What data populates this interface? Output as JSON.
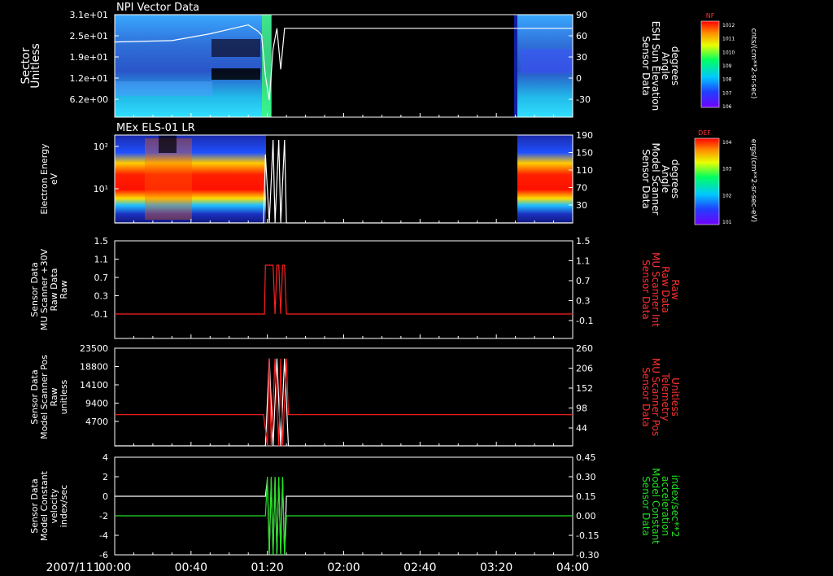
{
  "date_label": "2007/111",
  "time_ticks": [
    "00:00",
    "00:40",
    "01:20",
    "02:00",
    "02:40",
    "03:20",
    "04:00"
  ],
  "chart_data": [
    {
      "type": "heatmap",
      "title": "NPI Vector Data",
      "ylabel": [
        "Sector",
        "Unitless"
      ],
      "yticks": [
        "3.1e+01",
        "2.5e+01",
        "1.9e+01",
        "1.2e+01",
        "6.2e+00"
      ],
      "y2label": [
        "Sensor Data",
        "ESH Sun Elevation",
        "Angle",
        "degrees"
      ],
      "y2ticks": [
        "90",
        "60",
        "30",
        "0",
        "-30"
      ],
      "y2lim": [
        -60,
        90
      ],
      "colorbar": {
        "label": "NF",
        "unit": "cnts/(cm**2-sr-sec)",
        "ticks": [
          "10^12",
          "10^11",
          "10^10",
          "10^9",
          "10^8",
          "10^7",
          "10^6"
        ]
      },
      "series": [
        {
          "time_min": [
            0,
            30,
            50,
            70,
            75,
            77,
            79,
            81,
            83,
            85,
            87,
            89,
            240
          ],
          "values": [
            50,
            52,
            62,
            75,
            66,
            60,
            0,
            -35,
            40,
            70,
            10,
            70,
            70
          ]
        }
      ]
    },
    {
      "type": "heatmap",
      "title": "MEx ELS-01 LR",
      "ylabel": [
        "Electron Energy",
        "eV"
      ],
      "yticks": [
        "10^2",
        "10^1"
      ],
      "y2label": [
        "Sensor Data",
        "Model Scanner",
        "Angle",
        "degrees"
      ],
      "y2ticks": [
        "190",
        "150",
        "110",
        "70",
        "30"
      ],
      "y2lim": [
        10,
        190
      ],
      "colorbar": {
        "label": "DEF",
        "unit": "ergs/(cm**2-sr-sec-eV)",
        "ticks": [
          "10^4",
          "10^3",
          "10^2",
          "10^1"
        ]
      },
      "series": [
        {
          "time_min": [
            0,
            78,
            79,
            81,
            83,
            84,
            86,
            87,
            89,
            90,
            240
          ],
          "values": [
            10,
            10,
            150,
            10,
            180,
            10,
            180,
            10,
            180,
            10,
            10
          ]
        }
      ]
    },
    {
      "type": "line",
      "ylabel": [
        "Sensor Data",
        "MU Scanner +30V",
        "Raw Data",
        "Raw"
      ],
      "yticks": [
        "1.5",
        "1.1",
        "0.7",
        "0.3",
        "-0.1"
      ],
      "ylim": [
        -0.5,
        1.5
      ],
      "y2label": [
        "Sensor Data",
        "MU Scanner Int",
        "Raw Data",
        "Raw"
      ],
      "y2ticks": [
        "1.5",
        "1.1",
        "0.7",
        "0.3",
        "-0.1"
      ],
      "series": [
        {
          "color": "#ff2020",
          "time_min": [
            0,
            78.5,
            79,
            83,
            84,
            85,
            86,
            87,
            88,
            89,
            90,
            240
          ],
          "values": [
            0,
            0,
            1,
            1,
            0,
            1,
            1,
            0,
            1,
            1,
            0,
            0
          ]
        }
      ]
    },
    {
      "type": "line",
      "ylabel": [
        "Sensor Data",
        "Model Scanner Pos",
        "Raw",
        "unitless"
      ],
      "yticks": [
        "23500",
        "18800",
        "14100",
        "9400",
        "4700"
      ],
      "ylim": [
        0,
        23500
      ],
      "y2label": [
        "Sensor Data",
        "MU Scanner Pos",
        "Telemetry",
        "Unitless"
      ],
      "y2ticks": [
        "260",
        "206",
        "152",
        "98",
        "44"
      ],
      "series": [
        {
          "color": "#ffffff",
          "time_min": [
            0,
            78,
            79,
            81,
            83,
            85,
            87,
            89,
            91,
            240
          ],
          "values": [
            0,
            0,
            0,
            21000,
            0,
            21000,
            0,
            21000,
            0,
            0
          ]
        },
        {
          "color": "#ff2020",
          "time_min": [
            0,
            78,
            80,
            81,
            82,
            84,
            86,
            87,
            88,
            90,
            91,
            240
          ],
          "values": [
            7500,
            7500,
            0,
            21000,
            0,
            21000,
            0,
            21000,
            0,
            21000,
            7500,
            7500
          ]
        }
      ]
    },
    {
      "type": "line",
      "ylabel": [
        "Sensor Data",
        "Model Constant",
        "velocity",
        "index/sec"
      ],
      "yticks": [
        "4",
        "2",
        "0",
        "-2",
        "-4",
        "-6"
      ],
      "ylim": [
        -6,
        4
      ],
      "y2label": [
        "Sensor Data",
        "Model Constant",
        "acceleration",
        "index/sec**2"
      ],
      "y2ticks": [
        "0.45",
        "0.30",
        "0.15",
        "0.00",
        "-0.15",
        "-0.30"
      ],
      "series": [
        {
          "color": "#ffffff",
          "time_min": [
            0,
            79,
            80,
            81,
            82,
            83,
            84,
            85,
            86,
            87,
            88,
            89,
            90,
            240
          ],
          "values": [
            0,
            0,
            1.8,
            -6,
            1.8,
            -6,
            1.8,
            -6,
            1.8,
            -6,
            1.8,
            -6,
            0,
            0
          ]
        },
        {
          "color": "#22dd22",
          "time_min": [
            0,
            79,
            80,
            81,
            82,
            83,
            84,
            85,
            86,
            87,
            88,
            89,
            90,
            240
          ],
          "values": [
            -2,
            -2,
            2,
            -6,
            2,
            -6,
            2,
            -6,
            2,
            -6,
            2,
            -6,
            -2,
            -2
          ]
        }
      ]
    }
  ]
}
